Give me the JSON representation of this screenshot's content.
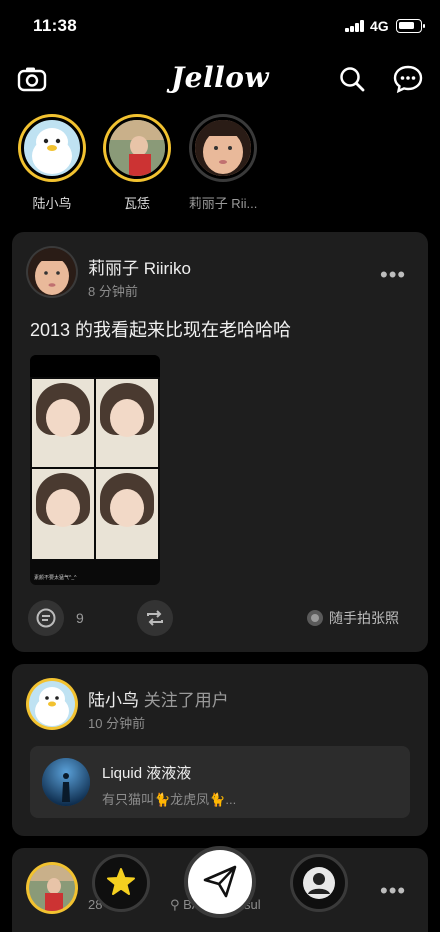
{
  "status_bar": {
    "time": "11:38",
    "network": "4G",
    "battery_level": 0.8
  },
  "header": {
    "logo": "Jellow",
    "icons": [
      "camera-icon",
      "search-icon",
      "chat-bubble-icon"
    ]
  },
  "stories": [
    {
      "name": "陆小鸟",
      "ring": "yellow"
    },
    {
      "name": "瓦恁",
      "ring": "yellow"
    },
    {
      "name": "莉丽子 Rii...",
      "ring": "gray"
    }
  ],
  "post": {
    "author": "莉丽子 Riiriko",
    "time": "8 分钟前",
    "text": "2013 的我看起来比现在老哈哈哈",
    "photo_caption": "素颜不要太猛气^_^",
    "comment_count": "9",
    "topic": "随手拍张照"
  },
  "activity": {
    "author": "陆小鸟",
    "action": "关注了用户",
    "time": "10 分钟前",
    "user": {
      "name": "Liquid 液液液",
      "bio": "有只猫叫🐈龙虎凤🐈..."
    }
  },
  "third_card": {
    "time_partial": "28",
    "location_partial": "BA",
    "location_partial_2": "sul"
  },
  "colors": {
    "accent_yellow": "#f2c230",
    "card_bg": "#1e1e1e",
    "background": "#000000"
  }
}
